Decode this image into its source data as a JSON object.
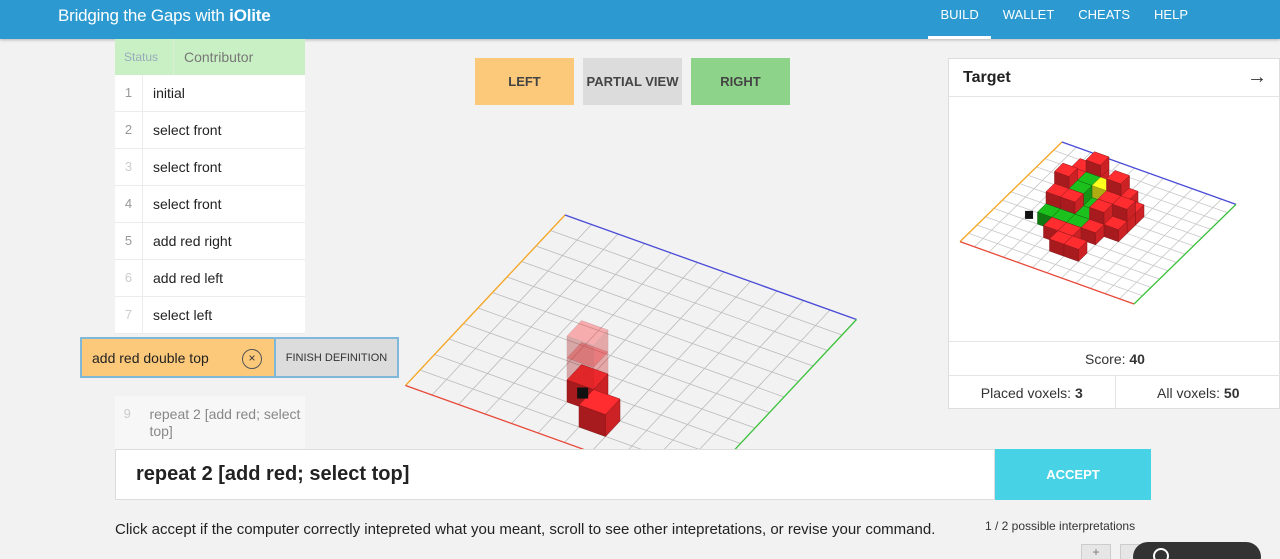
{
  "header": {
    "brand_prefix": "Bridging the Gaps with ",
    "brand_bold": "iOlite",
    "nav": [
      {
        "label": "BUILD",
        "active": true
      },
      {
        "label": "WALLET",
        "active": false
      },
      {
        "label": "CHEATS",
        "active": false
      },
      {
        "label": "HELP",
        "active": false
      }
    ]
  },
  "history": {
    "col_status": "Status",
    "col_contributor": "Contributor",
    "rows": [
      {
        "num": "1",
        "text": "initial"
      },
      {
        "num": "2",
        "text": "select front"
      },
      {
        "num": "3",
        "text": "select front"
      },
      {
        "num": "4",
        "text": "select front"
      },
      {
        "num": "5",
        "text": "add red right"
      },
      {
        "num": "6",
        "text": "add red left"
      },
      {
        "num": "7",
        "text": "select left"
      }
    ],
    "definition": {
      "name": "add red double top",
      "close": "×",
      "finish": "FINISH DEFINITION"
    },
    "future": {
      "num": "9",
      "text": "repeat 2 [add red; select top]"
    }
  },
  "views": {
    "left": "LEFT",
    "partial": "PARTIAL VIEW",
    "right": "RIGHT"
  },
  "target": {
    "title": "Target",
    "arrow": "→",
    "score_label": "Score: ",
    "score": "40",
    "placed_label": "Placed voxels: ",
    "placed": "3",
    "all_label": "All voxels: ",
    "all": "50"
  },
  "command": {
    "text": "repeat 2 [add red; select top]",
    "accept": "ACCEPT",
    "help": "Click accept if the computer correctly intepreted what you meant, scroll to see other intepretations, or revise your command.",
    "interpretations": "1 / 2 possible interpretations",
    "plus": "+"
  },
  "colors": {
    "nav": "#2c9ad0",
    "left": "#fcc97a",
    "partial": "#dcdcdc",
    "right": "#8ed38a",
    "accept": "#48d2e6",
    "voxel_red": "#e8262a",
    "voxel_green": "#19a819",
    "voxel_yellow": "#f2f21a",
    "voxel_black": "#111111"
  }
}
